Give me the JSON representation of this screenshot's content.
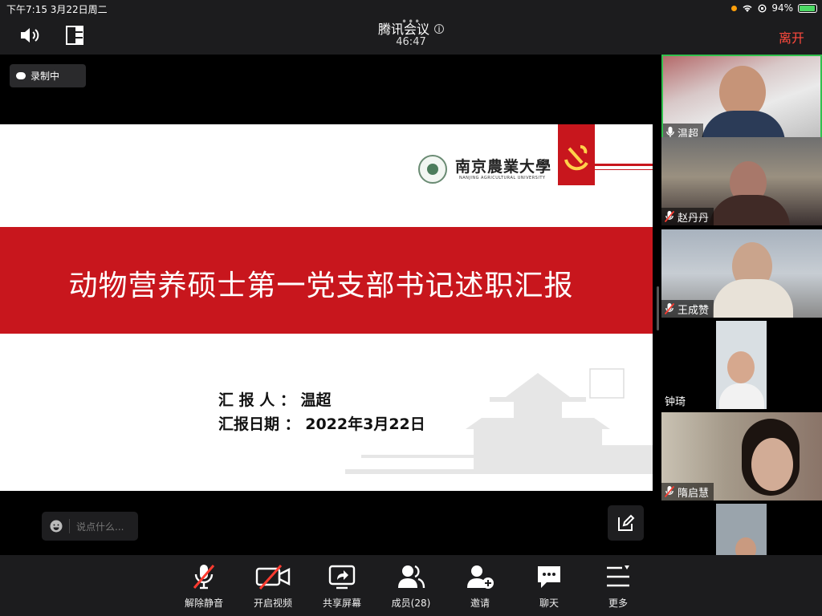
{
  "status_bar": {
    "time_date": "下午7:15   3月22日周二",
    "battery": "94%"
  },
  "header": {
    "title": "腾讯会议",
    "timer": "46:47",
    "leave_label": "离开"
  },
  "recording": {
    "label": "录制中"
  },
  "slide": {
    "title": "动物营养硕士第一党支部书记述职汇报",
    "university_cn": "南京農業大學",
    "university_en": "NANJING AGRICULTURAL UNIVERSITY",
    "reporter_line": "汇  报  人  ：  温超",
    "date_line": "汇报日期  ：  2022年3月22日"
  },
  "chat": {
    "placeholder": "说点什么..."
  },
  "participants": [
    {
      "name": "温超"
    },
    {
      "name": "赵丹丹"
    },
    {
      "name": "王成赞"
    },
    {
      "name": "钟琦"
    },
    {
      "name": "隋启慧"
    }
  ],
  "toolbar": {
    "unmute": "解除静音",
    "start_video": "开启视频",
    "share_screen": "共享屏幕",
    "members": "成员(28)",
    "invite": "邀请",
    "chat": "聊天",
    "more": "更多"
  },
  "colors": {
    "accent_red": "#c8161d",
    "leave_red": "#ff4a3d",
    "active_speaker": "#31c04d"
  }
}
